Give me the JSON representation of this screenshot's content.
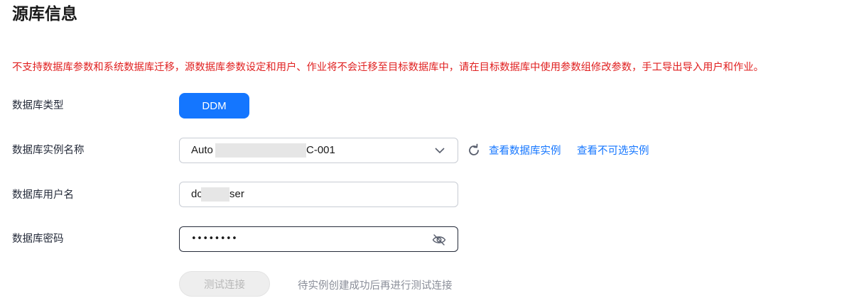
{
  "page": {
    "title": "源库信息"
  },
  "warning": "不支持数据库参数和系统数据库迁移，源数据库参数设定和用户、作业将不会迁移至目标数据库中，请在目标数据库中使用参数组修改参数，手工导出导入用户和作业。",
  "db_type": {
    "label": "数据库类型",
    "value": "DDM"
  },
  "instance": {
    "label": "数据库实例名称",
    "value_prefix": "Auto",
    "value_suffix": "C-001",
    "refresh_icon": "refresh-icon",
    "link_view": "查看数据库实例",
    "link_unavailable": "查看不可选实例"
  },
  "username": {
    "label": "数据库用户名",
    "value_prefix": "dc",
    "value_suffix": "ser"
  },
  "password": {
    "label": "数据库密码",
    "value": "••••••••",
    "toggle_icon": "eye-off-icon"
  },
  "test": {
    "button_label": "测试连接",
    "hint": "待实例创建成功后再进行测试连接"
  },
  "colors": {
    "primary": "#1476ff",
    "warning": "#e02020",
    "disabled_bg": "#eeeeee"
  }
}
